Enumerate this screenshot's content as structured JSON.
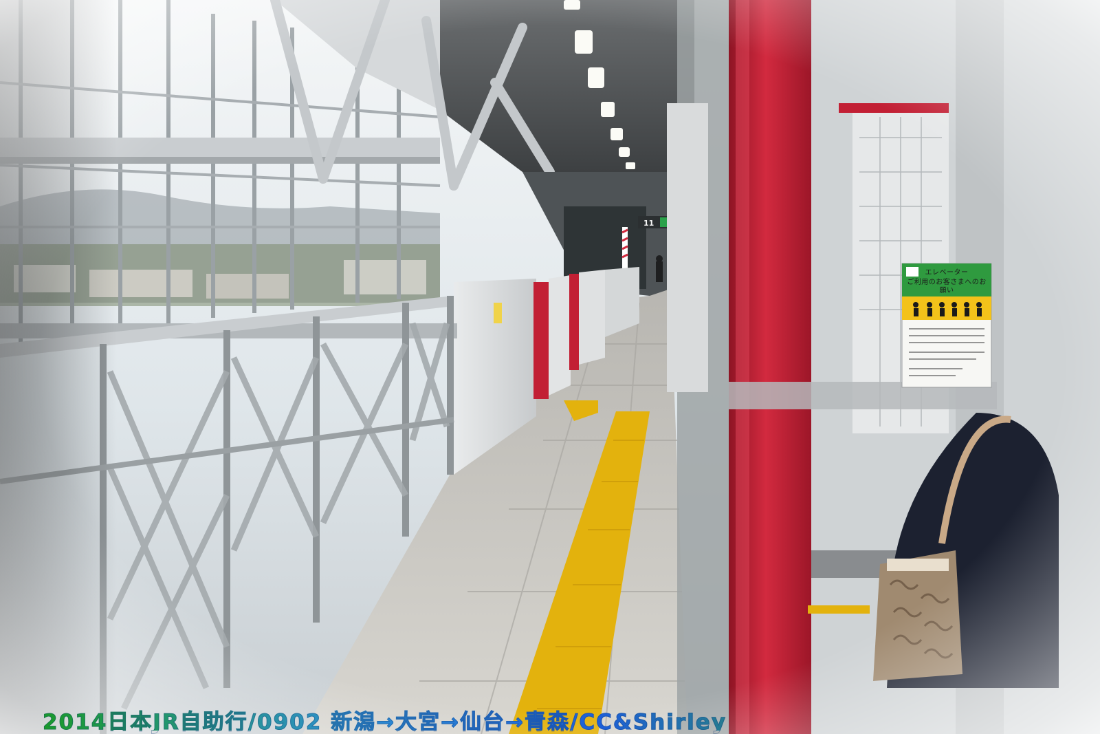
{
  "caption": "2014日本JR自助行/0902 新潟→大宮→仙台→青森/CC&Shirley",
  "elevator_sign": {
    "title": "エレベーター",
    "subtitle": "ご利用のお客さまへのお願い"
  },
  "platform_sign": {
    "number": "11"
  },
  "colors": {
    "sky": "#e8eef2",
    "steel": "#b9bfc3",
    "red_pillar": "#c21f34",
    "tactile_yellow": "#e3b20d",
    "floor": "#c9c7c1",
    "sign_green": "#2f9a3f"
  }
}
